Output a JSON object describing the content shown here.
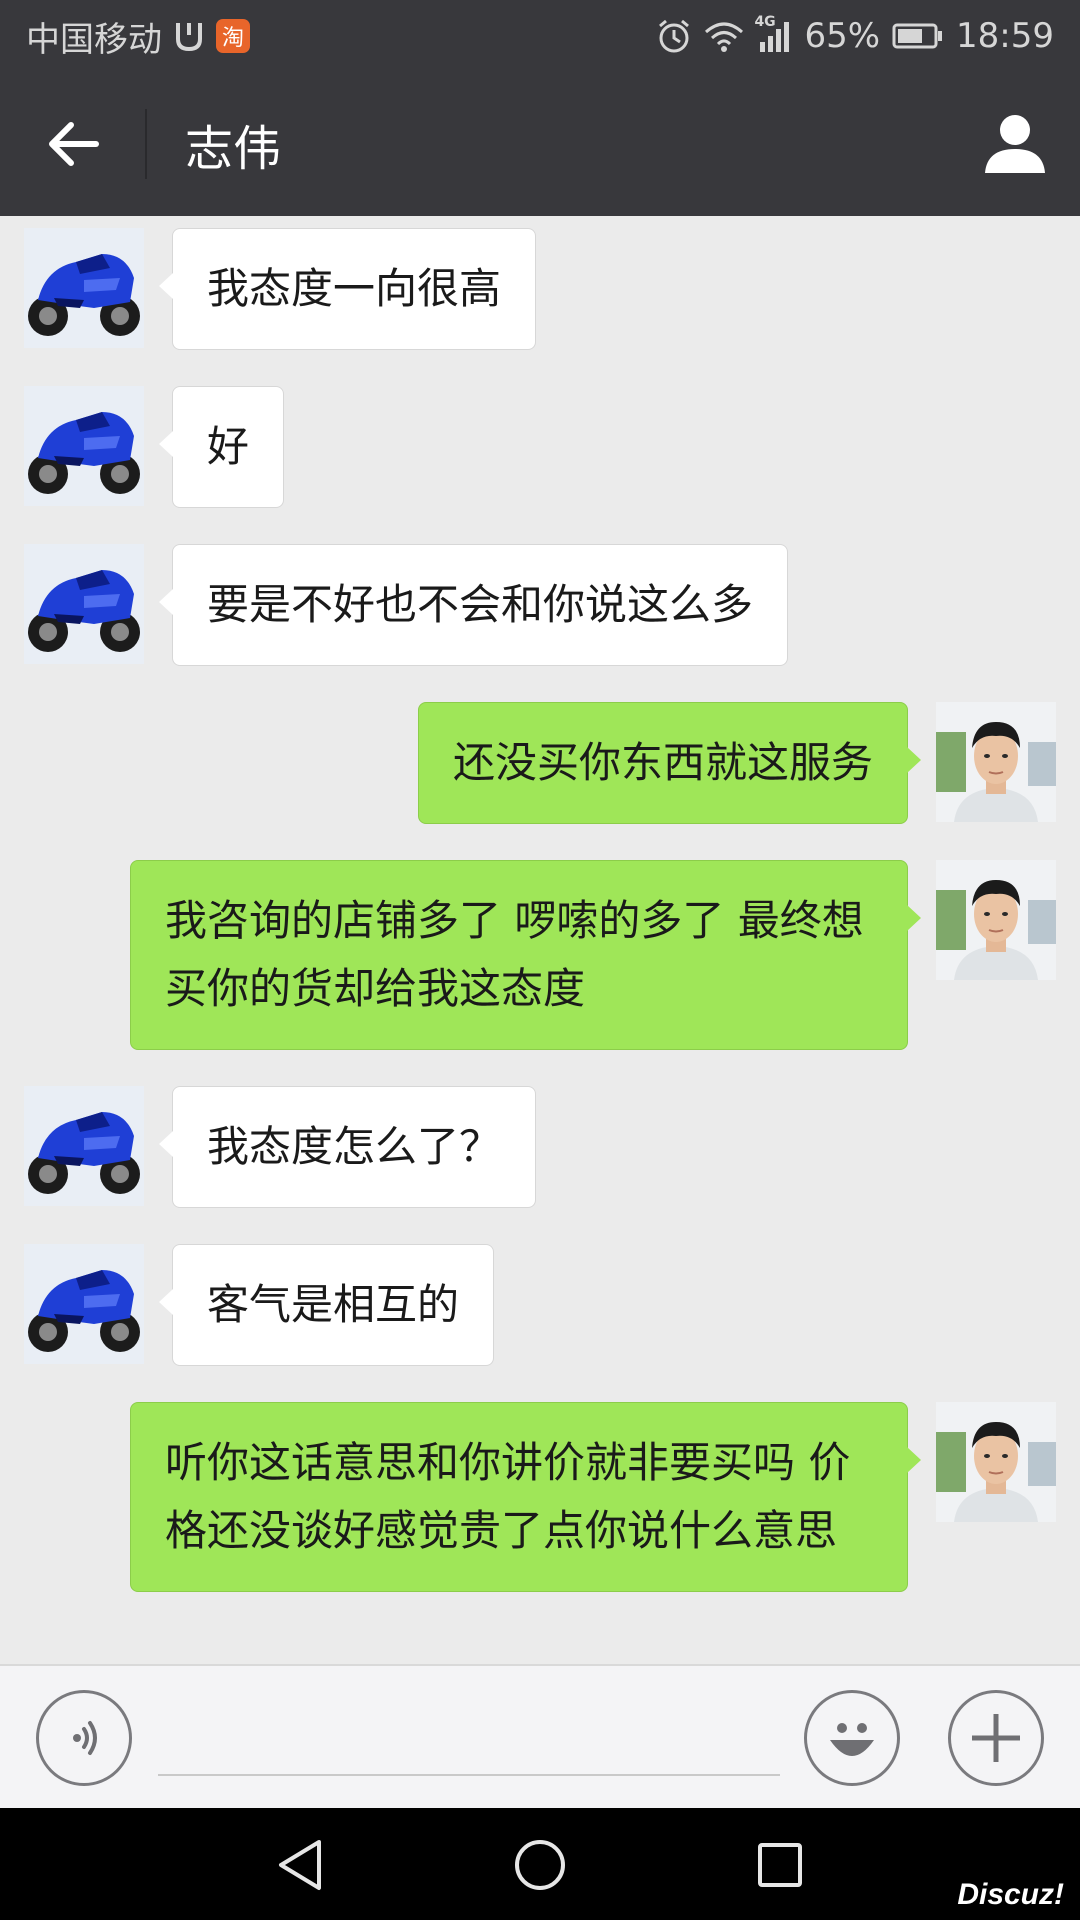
{
  "status_bar": {
    "carrier": "中国移动",
    "taobao_badge": "淘",
    "network": "4G",
    "battery_percent": "65%",
    "time": "18:59"
  },
  "header": {
    "title": "志伟"
  },
  "messages": [
    {
      "side": "left",
      "sender": "志伟",
      "text": "我态度一向很高"
    },
    {
      "side": "left",
      "sender": "志伟",
      "text": "好"
    },
    {
      "side": "left",
      "sender": "志伟",
      "text": "要是不好也不会和你说这么多"
    },
    {
      "side": "right",
      "sender": "me",
      "text": "还没买你东西就这服务"
    },
    {
      "side": "right",
      "sender": "me",
      "text": "我咨询的店铺多了 啰嗦的多了   最终想买你的货却给我这态度"
    },
    {
      "side": "left",
      "sender": "志伟",
      "text": "我态度怎么了？"
    },
    {
      "side": "left",
      "sender": "志伟",
      "text": "客气是相互的"
    },
    {
      "side": "right",
      "sender": "me",
      "text": "听你这话意思和你讲价就非要买吗  价格还没谈好感觉贵了点你说什么意思"
    }
  ],
  "watermark": "Discuz!",
  "colors": {
    "header_bg": "#38383c",
    "chat_bg": "#ebebeb",
    "sent_bubble": "#9fe658",
    "received_bubble": "#ffffff"
  }
}
